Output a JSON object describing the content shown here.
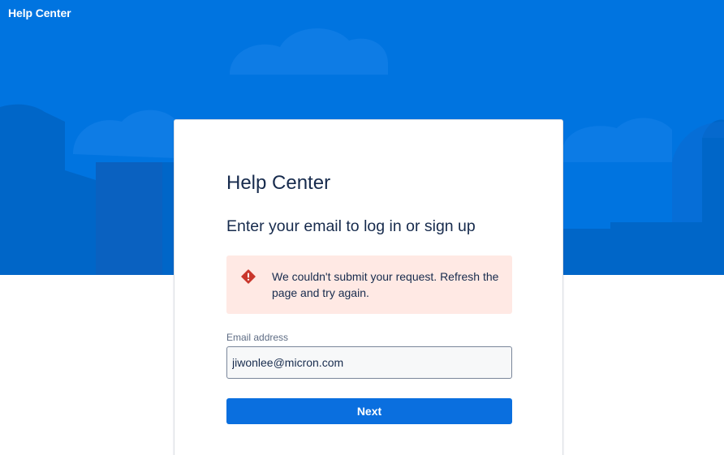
{
  "header": {
    "brand": "Help Center"
  },
  "card": {
    "title": "Help Center",
    "subtitle": "Enter your email to log in or sign up"
  },
  "alert": {
    "icon": "warning-icon",
    "message": "We couldn't submit your request. Refresh the page and try again."
  },
  "form": {
    "email_label": "Email address",
    "email_value": "jiwonlee@micron.com",
    "next_label": "Next"
  },
  "colors": {
    "hero": "#0074e0",
    "primary_button": "#0a6fdf",
    "alert_background": "#ffe9e4",
    "alert_icon": "#c9372c",
    "text": "#172b4d"
  }
}
